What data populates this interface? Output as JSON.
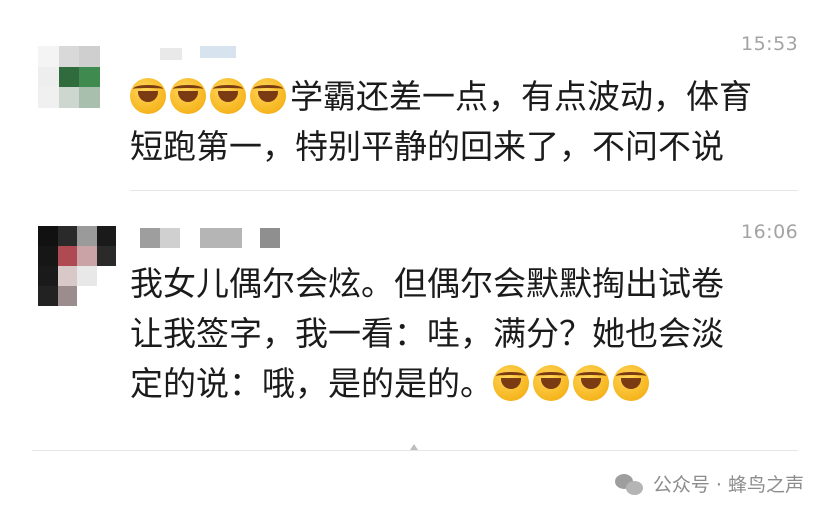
{
  "messages": [
    {
      "time": "15:53",
      "lines": [
        "学霸还差一点，有点波动，体育",
        "短跑第一，特别平静的回来了，不问不说"
      ],
      "leading_emojis": [
        "crying-laughing-emoji",
        "crying-laughing-emoji",
        "crying-laughing-emoji",
        "crying-laughing-emoji"
      ],
      "trailing_emojis": []
    },
    {
      "time": "16:06",
      "lines": [
        "我女儿偶尔会炫。但偶尔会默默掏出试卷",
        "让我签字，我一看：哇，满分？她也会淡",
        "定的说：哦，是的是的。"
      ],
      "leading_emojis": [],
      "trailing_emojis": [
        "crying-laughing-emoji",
        "crying-laughing-emoji",
        "crying-laughing-emoji",
        "crying-laughing-emoji"
      ]
    }
  ],
  "footer": {
    "icon": "wechat-icon",
    "text": "公众号 · 蜂鸟之声"
  },
  "colors": {
    "timestamp": "#a3a3a3",
    "divider": "#e6e6e6",
    "emoji": "#f6b51e"
  }
}
